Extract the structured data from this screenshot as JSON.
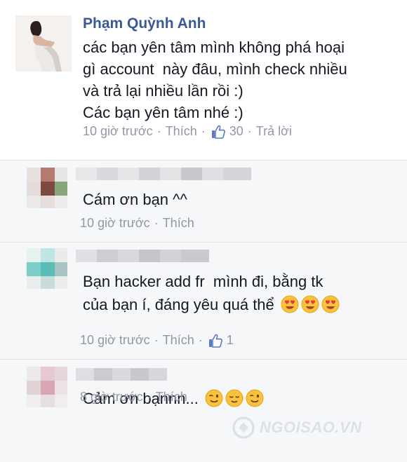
{
  "main_comment": {
    "author": "Phạm Quỳnh Anh",
    "lines": [
      "các bạn yên tâm mình không phá hoại",
      "gì account  này đâu, mình check nhiều",
      "và trả lại nhiều lần rồi :)",
      "Các bạn yên tâm nhé :)"
    ],
    "time": "10 giờ trước",
    "like_label": "Thích",
    "like_count": "30",
    "reply_label": "Trả lời",
    "separator": "·",
    "like_icon": "thumbs-up-icon"
  },
  "replies": [
    {
      "lines": [
        "Cám ơn bạn ^^"
      ],
      "time": "10 giờ trước",
      "like_label": "Thích",
      "separator": "·"
    },
    {
      "lines": [
        "Bạn hacker add fr  mình đi, bằng tk",
        "của bạn í, đáng yêu quá thể"
      ],
      "emojis": [
        "heart-eyes-emoji",
        "heart-eyes-emoji",
        "heart-eyes-emoji"
      ],
      "time": "10 giờ trước",
      "like_label": "Thích",
      "like_count": "1",
      "separator": "·",
      "like_icon": "thumbs-up-icon"
    },
    {
      "lines": [
        "Cảm ơn bạnnn..."
      ],
      "emojis": [
        "wink-emoji",
        "relieved-emoji",
        "wink-emoji"
      ],
      "time": "8 giờ trước",
      "like_label": "Thích",
      "separator": "·"
    }
  ],
  "watermark": "NGOISAO.VN",
  "colors": {
    "author": "#3b5998",
    "meta": "#9197a3",
    "text": "#141823",
    "reply_bg": "#f6f7f9",
    "like_icon": "#5b7bc0"
  }
}
